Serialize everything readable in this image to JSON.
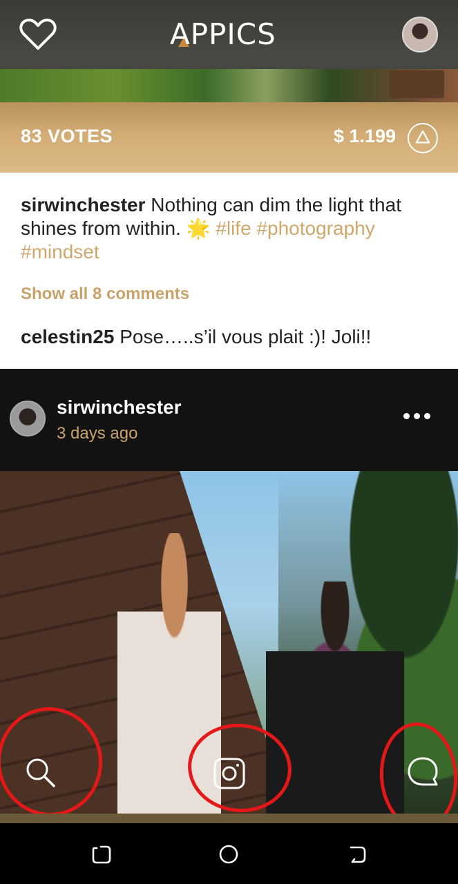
{
  "header": {
    "app_title": "APPICS",
    "icons": {
      "left": "heart-icon",
      "right": "profile-avatar"
    }
  },
  "vote_bar": {
    "votes": "83 VOTES",
    "price": "$ 1.199",
    "icon": "upvote-triangle-icon"
  },
  "caption": {
    "username": "sirwinchester",
    "text": " Nothing can dim the light that shines from within. ",
    "emoji": "🌟",
    "tags": [
      "#life",
      "#photography",
      "#mindset"
    ]
  },
  "comments": {
    "show_all": "Show all 8 comments",
    "items": [
      {
        "username": "celestin25",
        "text": " Pose…..s’il vous plait :)! Joli!!"
      }
    ]
  },
  "post": {
    "username": "sirwinchester",
    "time": "3 days ago"
  },
  "bottom_nav": {
    "items": [
      "search-icon",
      "instagram-icon",
      "chat-icon"
    ]
  },
  "system_nav": {
    "items": [
      "recents-icon",
      "home-icon",
      "back-icon"
    ]
  },
  "colors": {
    "accent_gold": "#c9a26a",
    "annotation_red": "#e41818"
  }
}
